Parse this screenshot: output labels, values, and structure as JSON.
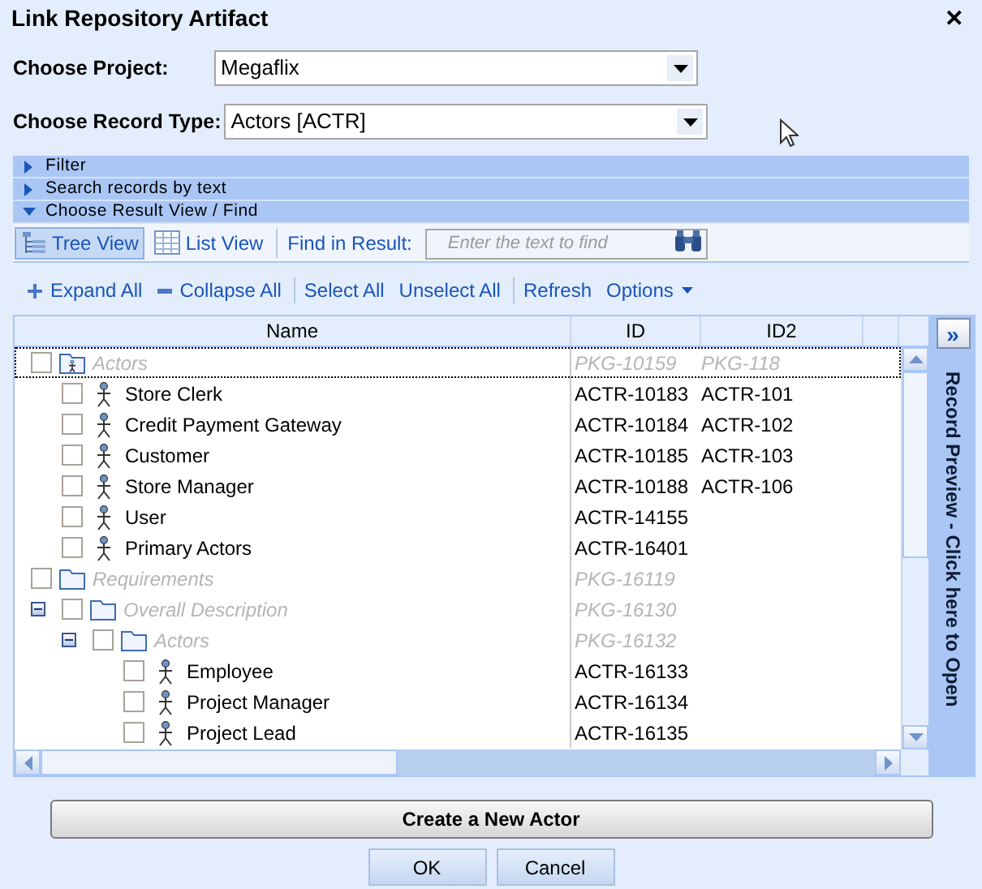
{
  "window": {
    "title": "Link Repository Artifact",
    "close": "✕"
  },
  "choosers": [
    {
      "label": "Choose Project:",
      "value": "Megaflix"
    },
    {
      "label": "Choose Record Type:",
      "value": "Actors [ACTR]"
    }
  ],
  "sections": [
    {
      "label": "Filter",
      "expanded": false
    },
    {
      "label": "Search records by text",
      "expanded": false
    },
    {
      "label": "Choose Result View / Find",
      "expanded": true
    }
  ],
  "view_tabs": [
    {
      "label": "Tree View",
      "kind": "tree",
      "selected": true
    },
    {
      "label": "List View",
      "kind": "list",
      "selected": false
    }
  ],
  "find": {
    "label": "Find in Result:",
    "placeholder": "Enter the text to find"
  },
  "actions": [
    {
      "label": "Expand All",
      "kind": "expand"
    },
    {
      "label": "Collapse All",
      "kind": "collapse"
    },
    {
      "label": "Select All",
      "kind": "sep"
    },
    {
      "label": "Unselect All",
      "kind": "plain"
    },
    {
      "label": "Refresh",
      "kind": "sep"
    },
    {
      "label": "Options",
      "kind": "menu"
    }
  ],
  "table": {
    "columns": [
      "Name",
      "ID",
      "ID2"
    ],
    "rows": [
      {
        "name": "Actors",
        "kind": "actor-package",
        "checked": false,
        "focused": true,
        "id": "PKG-10159",
        "id2": "PKG-118",
        "children": [
          {
            "name": "Store Clerk",
            "kind": "actor",
            "checked": false,
            "id": "ACTR-10183",
            "id2": "ACTR-101"
          },
          {
            "name": "Credit Payment Gateway",
            "kind": "actor",
            "checked": false,
            "id": "ACTR-10184",
            "id2": "ACTR-102"
          },
          {
            "name": "Customer",
            "kind": "actor",
            "checked": false,
            "id": "ACTR-10185",
            "id2": "ACTR-103"
          },
          {
            "name": "Store Manager",
            "kind": "actor",
            "checked": false,
            "id": "ACTR-10188",
            "id2": "ACTR-106"
          },
          {
            "name": "User",
            "kind": "actor",
            "checked": false,
            "id": "ACTR-14155"
          },
          {
            "name": "Primary Actors",
            "kind": "actor",
            "checked": false,
            "id": "ACTR-16401"
          }
        ]
      },
      {
        "name": "Requirements",
        "kind": "package",
        "checked": false,
        "id": "PKG-16119",
        "children": [
          {
            "name": "Overall Description",
            "kind": "package",
            "checked": false,
            "expanded": true,
            "id": "PKG-16130",
            "children": [
              {
                "name": "Actors",
                "kind": "package",
                "checked": false,
                "expanded": true,
                "id": "PKG-16132",
                "children": [
                  {
                    "name": "Employee",
                    "kind": "actor",
                    "checked": false,
                    "id": "ACTR-16133"
                  },
                  {
                    "name": "Project Manager",
                    "kind": "actor",
                    "checked": false,
                    "id": "ACTR-16134"
                  },
                  {
                    "name": "Project Lead",
                    "kind": "actor",
                    "checked": false,
                    "id": "ACTR-16135"
                  }
                ]
              }
            ]
          }
        ]
      }
    ]
  },
  "preview": {
    "button": "»",
    "label": "Record Preview - Click here to Open"
  },
  "create_button": {
    "label": "Create a New Actor"
  },
  "buttons": [
    {
      "label": "OK"
    },
    {
      "label": "Cancel"
    }
  ]
}
